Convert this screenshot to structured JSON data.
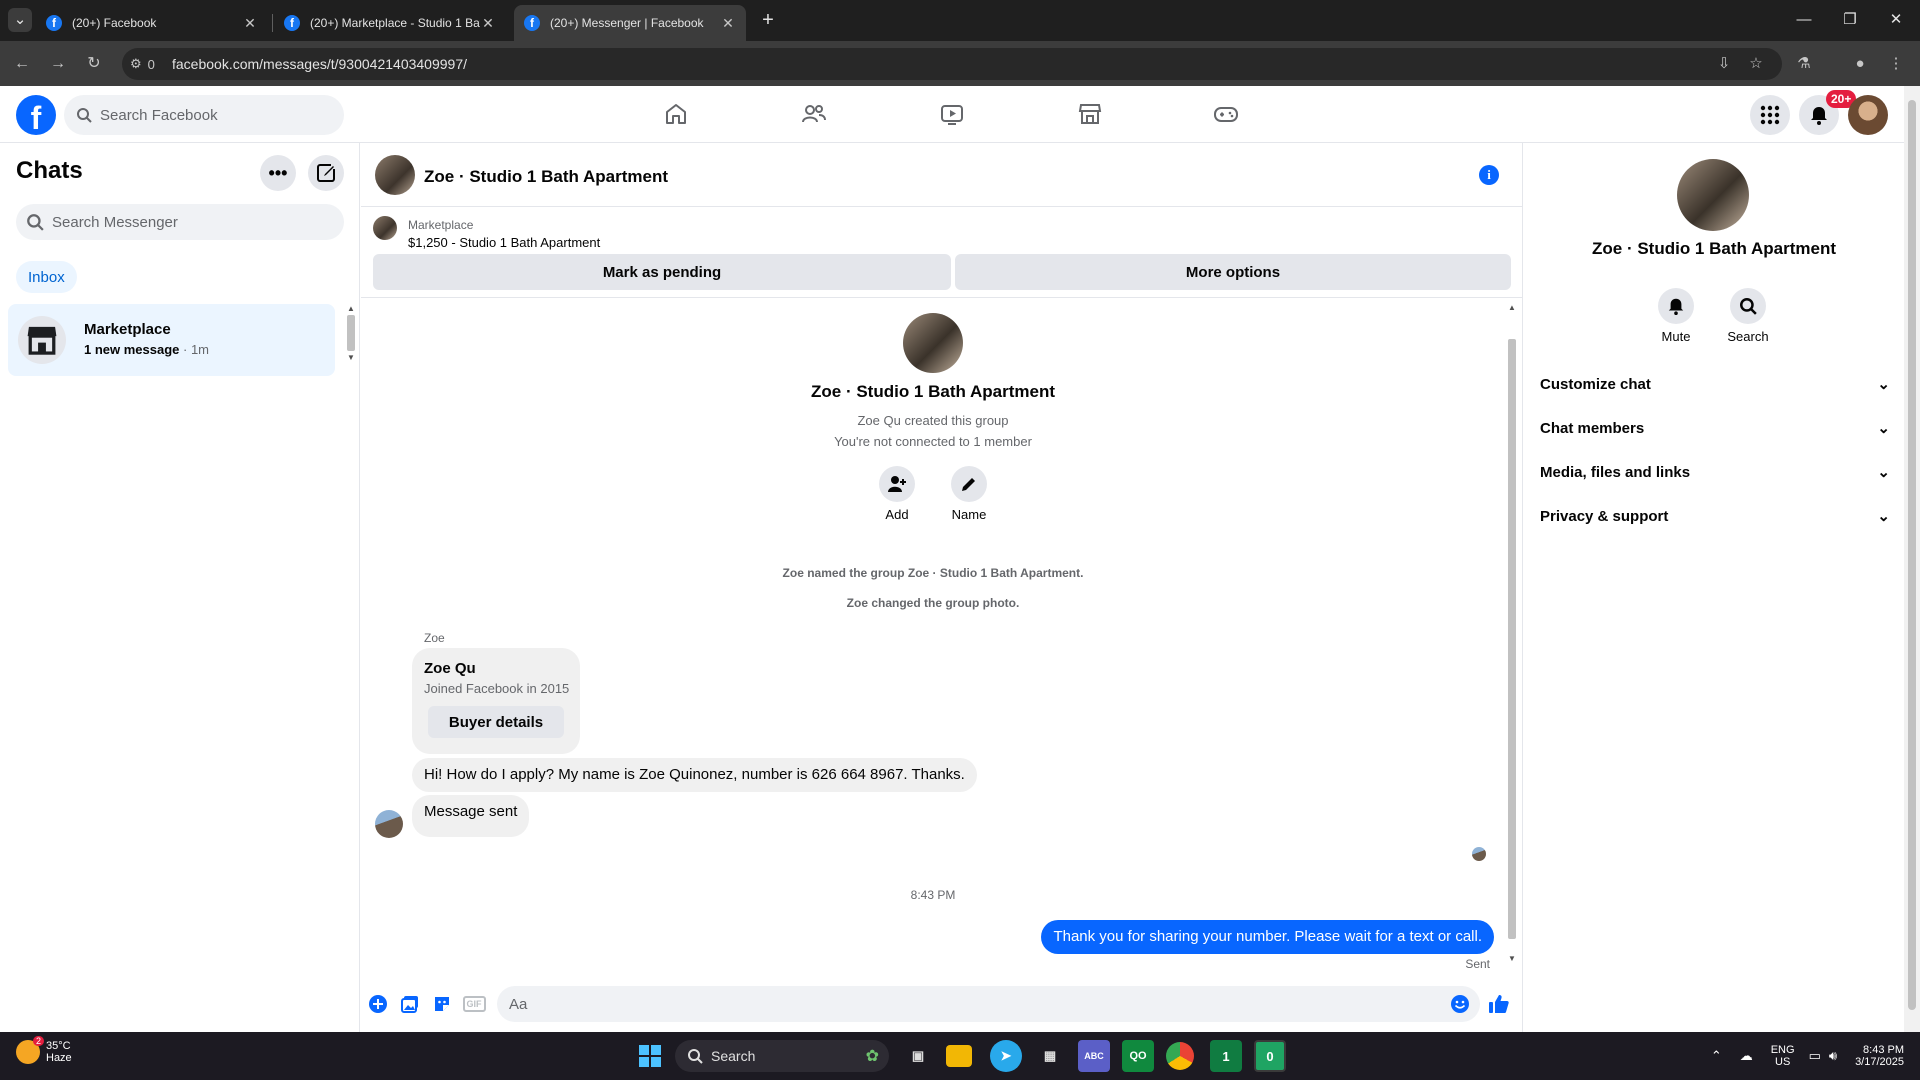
{
  "browser": {
    "tabs": [
      {
        "title": "(20+) Facebook",
        "active": false
      },
      {
        "title": "(20+) Marketplace - Studio 1 Bath Apartment",
        "active": false
      },
      {
        "title": "(20+) Messenger | Facebook",
        "active": true
      }
    ],
    "new_tab": "+",
    "site_info_count": "0",
    "url": "facebook.com/messages/t/9300421403409997/"
  },
  "fb": {
    "logo": "f",
    "search_placeholder": "Search Facebook",
    "nav_icons": [
      "home-icon",
      "friends-icon",
      "video-icon",
      "marketplace-icon",
      "gaming-icon"
    ],
    "notification_badge": "20+"
  },
  "left": {
    "title": "Chats",
    "search_placeholder": "Search Messenger",
    "inbox_label": "Inbox",
    "chat": {
      "name": "Marketplace",
      "unread": "1 new message",
      "sep": " · ",
      "time": "1m"
    }
  },
  "conversation": {
    "title": "Zoe · Studio 1 Bath Apartment",
    "marketplace_label": "Marketplace",
    "listing": "$1,250 - Studio 1 Bath Apartment",
    "mark_pending": "Mark as pending",
    "more_options": "More options",
    "group_title": "Zoe · Studio 1 Bath Apartment",
    "created_by": "Zoe Qu created this group",
    "not_connected": "You're not connected to 1 member",
    "add_label": "Add",
    "name_label": "Name",
    "event_named": "Zoe named the group Zoe · Studio 1 Bath Apartment.",
    "event_photo": "Zoe changed the group photo.",
    "sender_name": "Zoe",
    "buyer_name": "Zoe Qu",
    "buyer_joined": "Joined Facebook in 2015",
    "buyer_details": "Buyer details",
    "msg1": "Hi! How do I apply? My name is Zoe Quinonez, number is 626 664 8967. Thanks.",
    "msg2": "Message sent",
    "timestamp": "8:43 PM",
    "outgoing": "Thank you for sharing your number. Please wait for a text or call.",
    "sent_status": "Sent",
    "composer_placeholder": "Aa"
  },
  "info": {
    "name": "Zoe · Studio 1 Bath Apartment",
    "mute_label": "Mute",
    "search_label": "Search",
    "sections": [
      "Customize chat",
      "Chat members",
      "Media, files and links",
      "Privacy & support"
    ]
  },
  "taskbar": {
    "weather_temp": "35°C",
    "weather_desc": "Haze",
    "weather_badge": "2",
    "search_label": "Search",
    "lang_top": "ENG",
    "lang_bottom": "US",
    "time": "8:43 PM",
    "date": "3/17/2025"
  },
  "colors": {
    "brand": "#0866ff",
    "inbox_bg": "#ebf5ff",
    "bubble_in": "#f0f0f0",
    "badge": "#e41e3f"
  }
}
